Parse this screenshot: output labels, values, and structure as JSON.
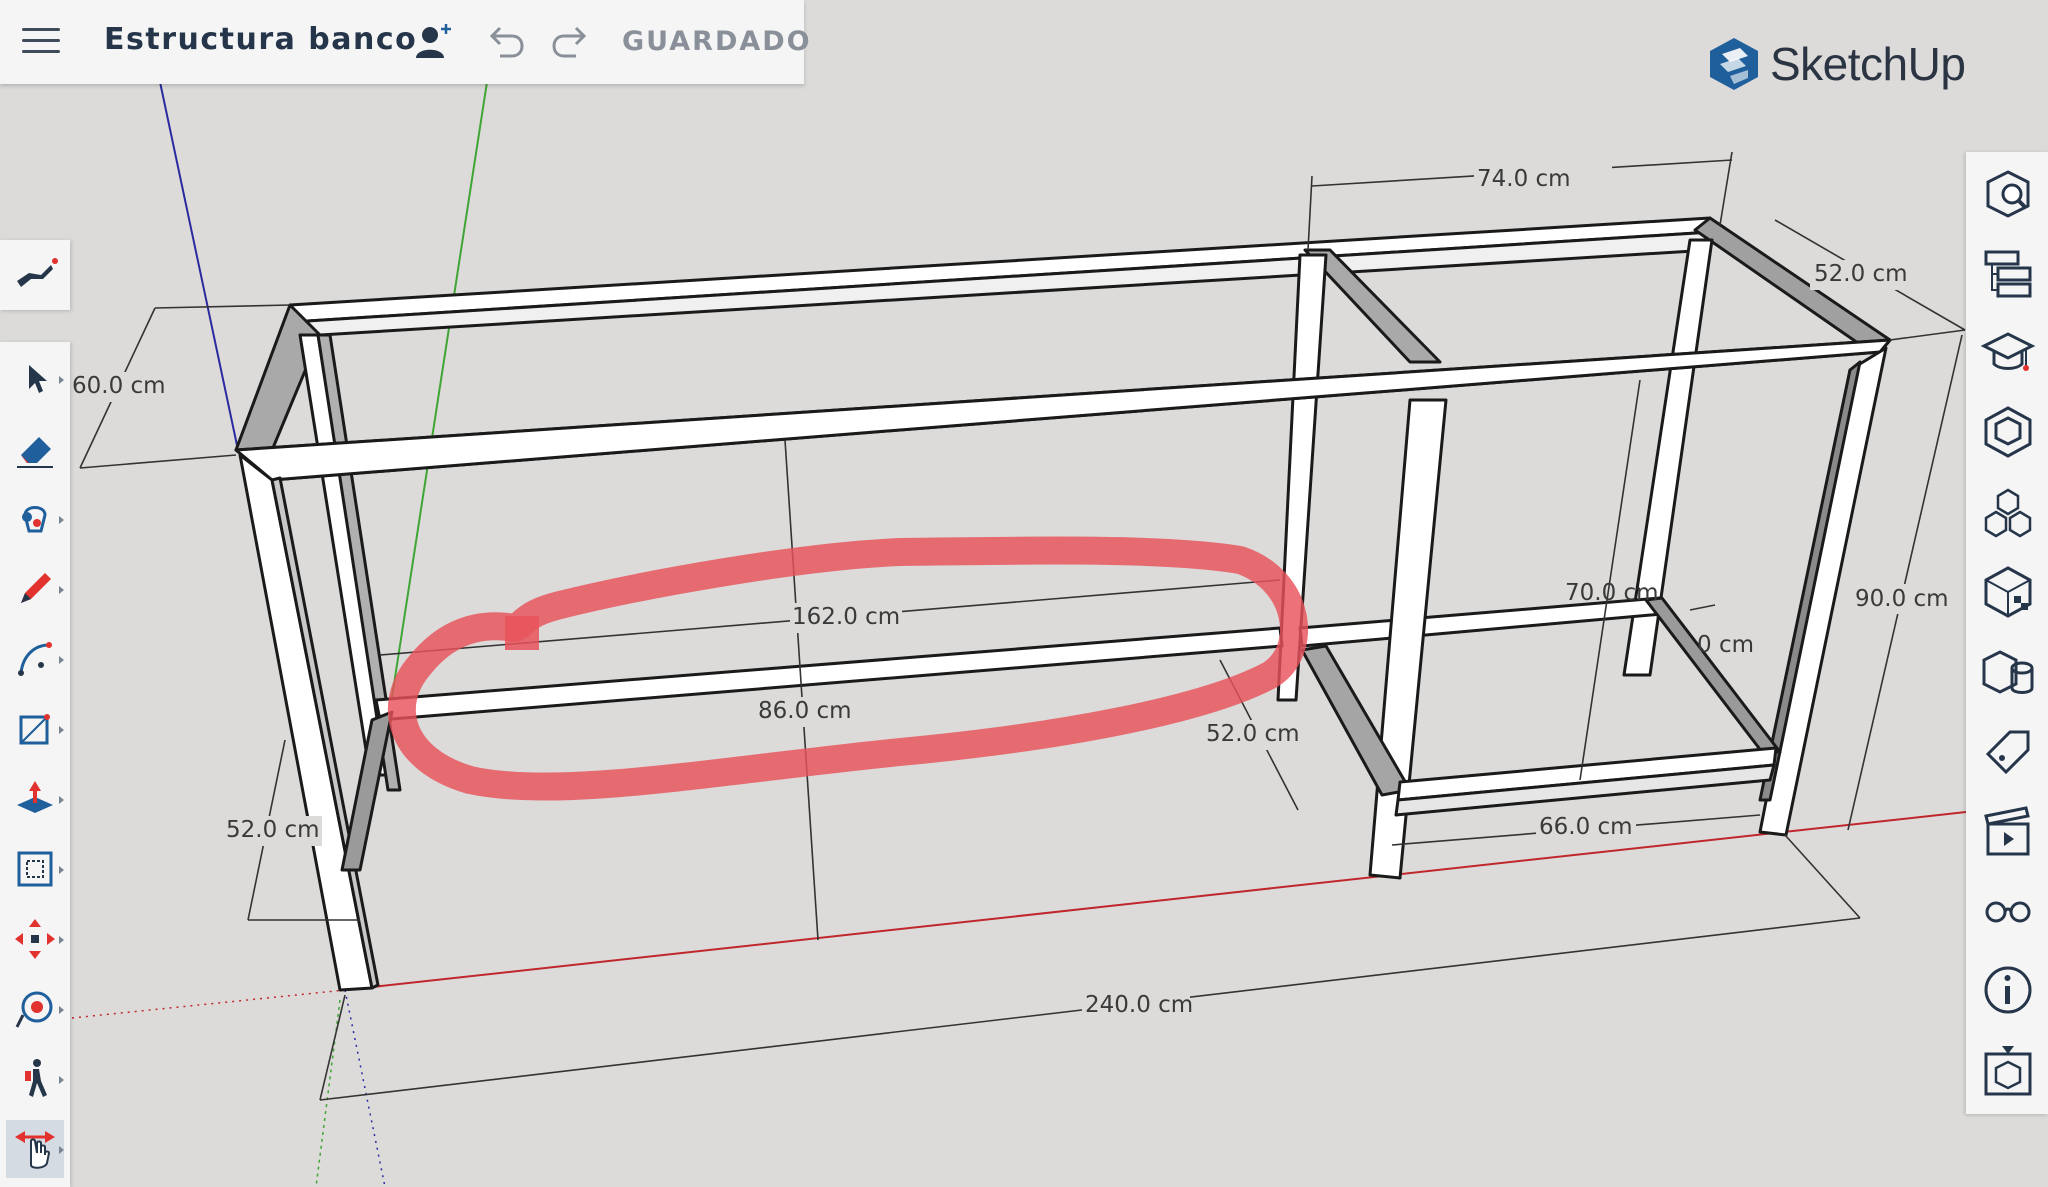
{
  "app": {
    "document_title": "Estructura banco",
    "save_status": "GUARDADO",
    "brand": "SketchUp"
  },
  "dimensions": {
    "d74": "74.0 cm",
    "d52_top": "52.0 cm",
    "d60": "60.0 cm",
    "d162": "162.0 cm",
    "d86": "86.0 cm",
    "d70": "70.0 cm",
    "d_partial": "0 cm",
    "d90": "90.0 cm",
    "d52_mid": "52.0 cm",
    "d52_left": "52.0 cm",
    "d66": "66.0 cm",
    "d240": "240.0 cm"
  },
  "left_tools": [
    "search-3d-warehouse",
    "select",
    "eraser",
    "paint-bucket",
    "pencil",
    "arc",
    "rectangle",
    "push-pull",
    "offset",
    "move",
    "tape-measure",
    "walk",
    "pan"
  ],
  "right_tools": [
    "entity-info",
    "outliner",
    "instructor",
    "components",
    "materials",
    "styles",
    "solid-tools",
    "tags",
    "scenes",
    "display",
    "info",
    "export"
  ],
  "colors": {
    "background": "#dcdbd9",
    "red_axis": "#c0272d",
    "green_axis": "#3fa535",
    "blue_axis": "#2a2aa0",
    "highlight": "#e8525a",
    "accent_blue": "#1f5f9b"
  }
}
